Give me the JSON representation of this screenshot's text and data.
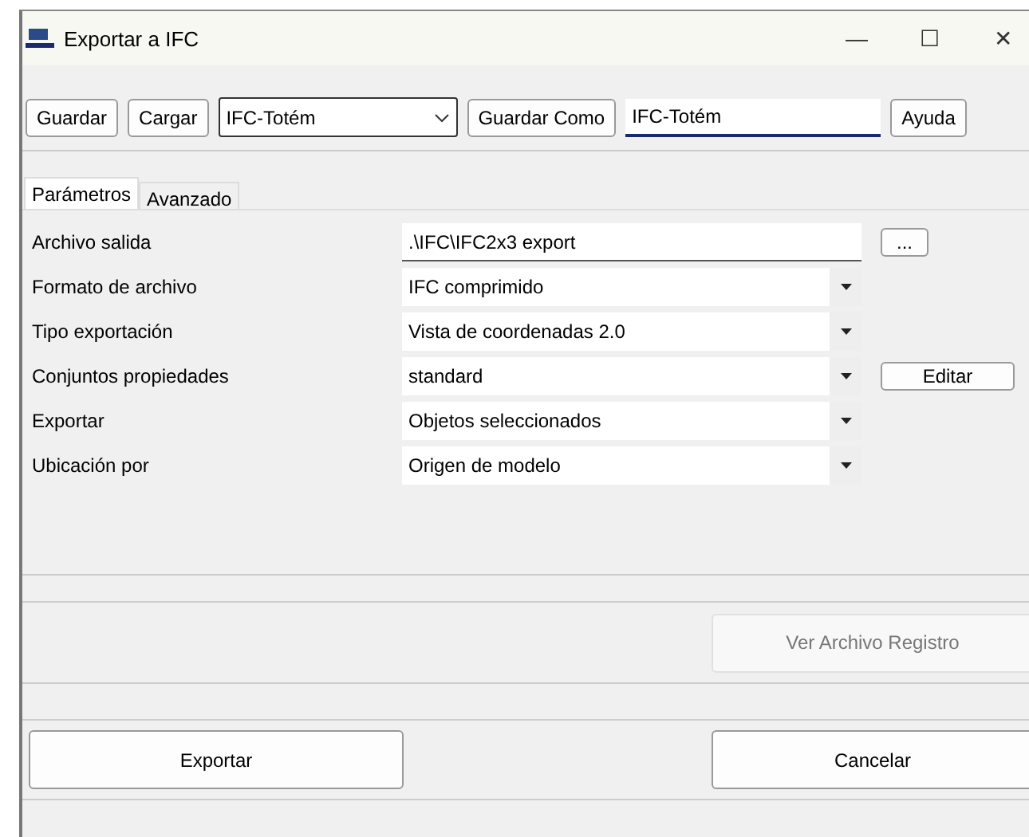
{
  "window": {
    "title": "Exportar a IFC",
    "controls": [
      "—",
      "☐",
      "✕"
    ]
  },
  "toolbar": {
    "save": "Guardar",
    "load": "Cargar",
    "config": "IFC-Totém",
    "save_as": "Guardar Como",
    "name_value": "IFC-Totém",
    "help": "Ayuda"
  },
  "tabs": [
    {
      "label": "Parámetros",
      "selected": true
    },
    {
      "label": "Avanzado",
      "selected": false
    }
  ],
  "fields": [
    {
      "kind": "text",
      "label": "Archivo salida",
      "value": ".\\IFC\\IFC2x3 export",
      "button": "..."
    },
    {
      "kind": "select",
      "label": "Formato de archivo",
      "value": "IFC comprimido"
    },
    {
      "kind": "select",
      "label": "Tipo exportación",
      "value": "Vista de coordenadas 2.0"
    },
    {
      "kind": "select",
      "label": "Conjuntos propiedades",
      "value": "standard",
      "button": "Editar"
    },
    {
      "kind": "select",
      "label": "Exportar",
      "value": "Objetos seleccionados"
    },
    {
      "kind": "select",
      "label": "Ubicación por",
      "value": "Origen de modelo"
    }
  ],
  "log_button": {
    "label": "Ver Archivo Registro",
    "disabled": true
  },
  "actions": [
    "Exportar",
    "Cancelar"
  ]
}
